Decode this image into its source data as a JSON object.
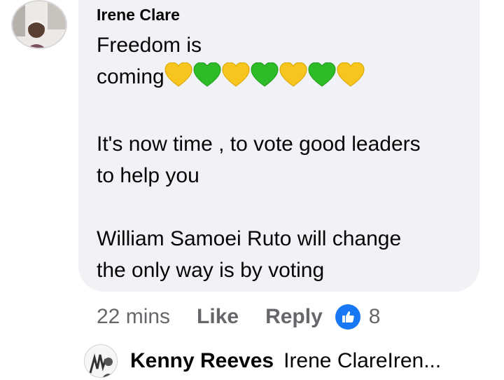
{
  "comment": {
    "author": "Irene Clare",
    "line1": "Freedom is",
    "line2": "coming",
    "emoji": [
      "yellow-heart-icon",
      "green-heart-icon",
      "yellow-heart-icon",
      "green-heart-icon",
      "yellow-heart-icon",
      "green-heart-icon",
      "yellow-heart-icon"
    ],
    "paragraph2": "It's now time , to vote good leaders\nto help you",
    "paragraph3": "William Samoei Ruto will change\nthe only way is by voting"
  },
  "actions": {
    "time": "22 mins",
    "like": "Like",
    "reply": "Reply",
    "reaction_count": "8"
  },
  "reply": {
    "author": "Kenny Reeves",
    "preview": "Irene ClareIren..."
  },
  "colors": {
    "bubble": "#f0f2f5",
    "like_blue": "#1877f2",
    "muted": "#65676b",
    "yellow_heart": "#f7c51e",
    "green_heart": "#2dbb27"
  }
}
